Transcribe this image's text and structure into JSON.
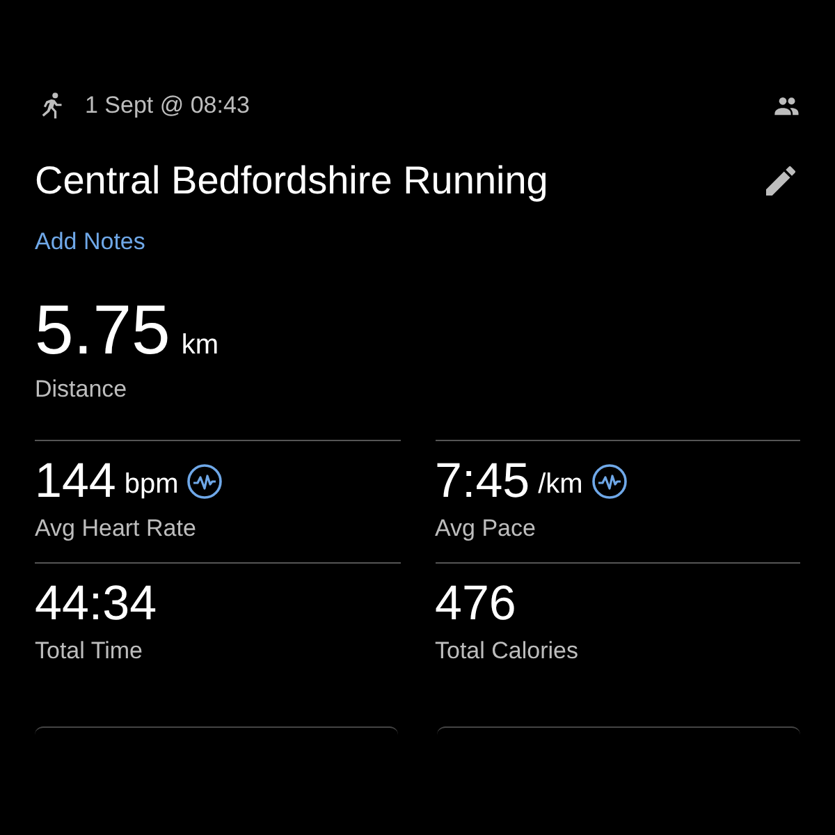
{
  "activity": {
    "date": "1 Sept @ 08:43",
    "title": "Central Bedfordshire Running",
    "notes_link": "Add Notes"
  },
  "distance": {
    "value": "5.75",
    "unit": "km",
    "label": "Distance"
  },
  "stats": [
    {
      "value": "144",
      "unit": "bpm",
      "label": "Avg Heart Rate",
      "has_chart": true
    },
    {
      "value": "7:45",
      "unit": "/km",
      "label": "Avg Pace",
      "has_chart": true
    },
    {
      "value": "44:34",
      "label": "Total Time",
      "has_chart": false
    },
    {
      "value": "476",
      "label": "Total Calories",
      "has_chart": false
    }
  ]
}
